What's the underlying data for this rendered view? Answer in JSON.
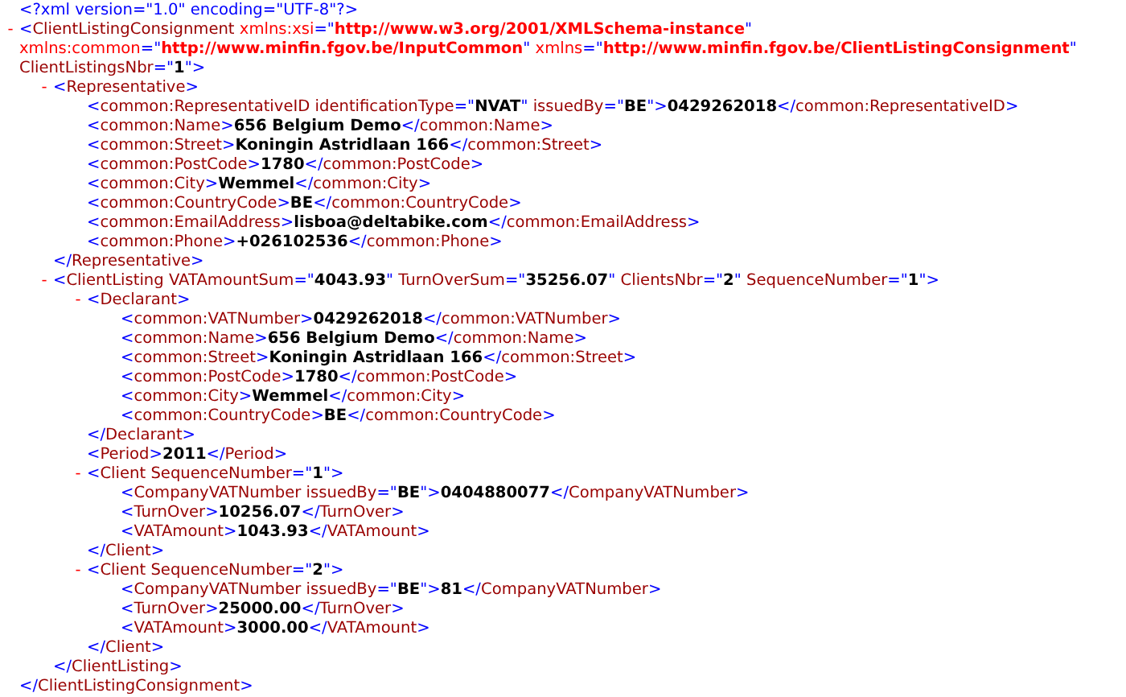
{
  "document": [
    {
      "open": [
        [
          {
            "kind": "punct",
            "text": "<?xml version=\"1.0\" encoding=\"UTF-8\"?>"
          }
        ]
      ]
    },
    {
      "toggle": "-",
      "open": [
        [
          {
            "kind": "punct",
            "text": "<"
          },
          {
            "kind": "tag",
            "text": "ClientListingConsignment"
          },
          {
            "kind": "ns-attr",
            "text": " xmlns:xsi"
          },
          {
            "kind": "punct",
            "text": "=\""
          },
          {
            "kind": "ns-value",
            "text": "http://www.w3.org/2001/XMLSchema-instance"
          },
          {
            "kind": "punct",
            "text": "\""
          }
        ],
        [
          {
            "kind": "ns-attr",
            "text": "xmlns:common"
          },
          {
            "kind": "punct",
            "text": "=\""
          },
          {
            "kind": "ns-value",
            "text": "http://www.minfin.fgov.be/InputCommon"
          },
          {
            "kind": "punct",
            "text": "\""
          },
          {
            "kind": "ns-attr",
            "text": " xmlns"
          },
          {
            "kind": "punct",
            "text": "=\""
          },
          {
            "kind": "ns-value",
            "text": "http://www.minfin.fgov.be/ClientListingConsignment"
          },
          {
            "kind": "punct",
            "text": "\""
          }
        ],
        [
          {
            "kind": "attr",
            "text": "ClientListingsNbr"
          },
          {
            "kind": "punct",
            "text": "=\""
          },
          {
            "kind": "value",
            "text": "1"
          },
          {
            "kind": "punct",
            "text": "\">"
          }
        ]
      ],
      "children": [
        {
          "toggle": "-",
          "open": [
            [
              {
                "kind": "punct",
                "text": "<"
              },
              {
                "kind": "tag",
                "text": "Representative"
              },
              {
                "kind": "punct",
                "text": ">"
              }
            ]
          ],
          "children": [
            {
              "open": [
                [
                  {
                    "kind": "punct",
                    "text": "<"
                  },
                  {
                    "kind": "tag",
                    "text": "common:RepresentativeID"
                  },
                  {
                    "kind": "attr",
                    "text": " identificationType"
                  },
                  {
                    "kind": "punct",
                    "text": "=\""
                  },
                  {
                    "kind": "value",
                    "text": "NVAT"
                  },
                  {
                    "kind": "punct",
                    "text": "\""
                  },
                  {
                    "kind": "attr",
                    "text": " issuedBy"
                  },
                  {
                    "kind": "punct",
                    "text": "=\""
                  },
                  {
                    "kind": "value",
                    "text": "BE"
                  },
                  {
                    "kind": "punct",
                    "text": "\">"
                  },
                  {
                    "kind": "value",
                    "text": "0429262018"
                  },
                  {
                    "kind": "punct",
                    "text": "</"
                  },
                  {
                    "kind": "tag",
                    "text": "common:RepresentativeID"
                  },
                  {
                    "kind": "punct",
                    "text": ">"
                  }
                ]
              ]
            },
            {
              "open": [
                [
                  {
                    "kind": "punct",
                    "text": "<"
                  },
                  {
                    "kind": "tag",
                    "text": "common:Name"
                  },
                  {
                    "kind": "punct",
                    "text": ">"
                  },
                  {
                    "kind": "value",
                    "text": "656 Belgium Demo"
                  },
                  {
                    "kind": "punct",
                    "text": "</"
                  },
                  {
                    "kind": "tag",
                    "text": "common:Name"
                  },
                  {
                    "kind": "punct",
                    "text": ">"
                  }
                ]
              ]
            },
            {
              "open": [
                [
                  {
                    "kind": "punct",
                    "text": "<"
                  },
                  {
                    "kind": "tag",
                    "text": "common:Street"
                  },
                  {
                    "kind": "punct",
                    "text": ">"
                  },
                  {
                    "kind": "value",
                    "text": "Koningin Astridlaan 166"
                  },
                  {
                    "kind": "punct",
                    "text": "</"
                  },
                  {
                    "kind": "tag",
                    "text": "common:Street"
                  },
                  {
                    "kind": "punct",
                    "text": ">"
                  }
                ]
              ]
            },
            {
              "open": [
                [
                  {
                    "kind": "punct",
                    "text": "<"
                  },
                  {
                    "kind": "tag",
                    "text": "common:PostCode"
                  },
                  {
                    "kind": "punct",
                    "text": ">"
                  },
                  {
                    "kind": "value",
                    "text": "1780"
                  },
                  {
                    "kind": "punct",
                    "text": "</"
                  },
                  {
                    "kind": "tag",
                    "text": "common:PostCode"
                  },
                  {
                    "kind": "punct",
                    "text": ">"
                  }
                ]
              ]
            },
            {
              "open": [
                [
                  {
                    "kind": "punct",
                    "text": "<"
                  },
                  {
                    "kind": "tag",
                    "text": "common:City"
                  },
                  {
                    "kind": "punct",
                    "text": ">"
                  },
                  {
                    "kind": "value",
                    "text": "Wemmel"
                  },
                  {
                    "kind": "punct",
                    "text": "</"
                  },
                  {
                    "kind": "tag",
                    "text": "common:City"
                  },
                  {
                    "kind": "punct",
                    "text": ">"
                  }
                ]
              ]
            },
            {
              "open": [
                [
                  {
                    "kind": "punct",
                    "text": "<"
                  },
                  {
                    "kind": "tag",
                    "text": "common:CountryCode"
                  },
                  {
                    "kind": "punct",
                    "text": ">"
                  },
                  {
                    "kind": "value",
                    "text": "BE"
                  },
                  {
                    "kind": "punct",
                    "text": "</"
                  },
                  {
                    "kind": "tag",
                    "text": "common:CountryCode"
                  },
                  {
                    "kind": "punct",
                    "text": ">"
                  }
                ]
              ]
            },
            {
              "open": [
                [
                  {
                    "kind": "punct",
                    "text": "<"
                  },
                  {
                    "kind": "tag",
                    "text": "common:EmailAddress"
                  },
                  {
                    "kind": "punct",
                    "text": ">"
                  },
                  {
                    "kind": "value",
                    "text": "lisboa@deltabike.com"
                  },
                  {
                    "kind": "punct",
                    "text": "</"
                  },
                  {
                    "kind": "tag",
                    "text": "common:EmailAddress"
                  },
                  {
                    "kind": "punct",
                    "text": ">"
                  }
                ]
              ]
            },
            {
              "open": [
                [
                  {
                    "kind": "punct",
                    "text": "<"
                  },
                  {
                    "kind": "tag",
                    "text": "common:Phone"
                  },
                  {
                    "kind": "punct",
                    "text": ">"
                  },
                  {
                    "kind": "value",
                    "text": "+026102536"
                  },
                  {
                    "kind": "punct",
                    "text": "</"
                  },
                  {
                    "kind": "tag",
                    "text": "common:Phone"
                  },
                  {
                    "kind": "punct",
                    "text": ">"
                  }
                ]
              ]
            }
          ],
          "close": [
            {
              "kind": "punct",
              "text": "</"
            },
            {
              "kind": "tag",
              "text": "Representative"
            },
            {
              "kind": "punct",
              "text": ">"
            }
          ]
        },
        {
          "toggle": "-",
          "open": [
            [
              {
                "kind": "punct",
                "text": "<"
              },
              {
                "kind": "tag",
                "text": "ClientListing"
              },
              {
                "kind": "attr",
                "text": " VATAmountSum"
              },
              {
                "kind": "punct",
                "text": "=\""
              },
              {
                "kind": "value",
                "text": "4043.93"
              },
              {
                "kind": "punct",
                "text": "\""
              },
              {
                "kind": "attr",
                "text": " TurnOverSum"
              },
              {
                "kind": "punct",
                "text": "=\""
              },
              {
                "kind": "value",
                "text": "35256.07"
              },
              {
                "kind": "punct",
                "text": "\""
              },
              {
                "kind": "attr",
                "text": " ClientsNbr"
              },
              {
                "kind": "punct",
                "text": "=\""
              },
              {
                "kind": "value",
                "text": "2"
              },
              {
                "kind": "punct",
                "text": "\""
              },
              {
                "kind": "attr",
                "text": " SequenceNumber"
              },
              {
                "kind": "punct",
                "text": "=\""
              },
              {
                "kind": "value",
                "text": "1"
              },
              {
                "kind": "punct",
                "text": "\">"
              }
            ]
          ],
          "children": [
            {
              "toggle": "-",
              "open": [
                [
                  {
                    "kind": "punct",
                    "text": "<"
                  },
                  {
                    "kind": "tag",
                    "text": "Declarant"
                  },
                  {
                    "kind": "punct",
                    "text": ">"
                  }
                ]
              ],
              "children": [
                {
                  "open": [
                    [
                      {
                        "kind": "punct",
                        "text": "<"
                      },
                      {
                        "kind": "tag",
                        "text": "common:VATNumber"
                      },
                      {
                        "kind": "punct",
                        "text": ">"
                      },
                      {
                        "kind": "value",
                        "text": "0429262018"
                      },
                      {
                        "kind": "punct",
                        "text": "</"
                      },
                      {
                        "kind": "tag",
                        "text": "common:VATNumber"
                      },
                      {
                        "kind": "punct",
                        "text": ">"
                      }
                    ]
                  ]
                },
                {
                  "open": [
                    [
                      {
                        "kind": "punct",
                        "text": "<"
                      },
                      {
                        "kind": "tag",
                        "text": "common:Name"
                      },
                      {
                        "kind": "punct",
                        "text": ">"
                      },
                      {
                        "kind": "value",
                        "text": "656 Belgium Demo"
                      },
                      {
                        "kind": "punct",
                        "text": "</"
                      },
                      {
                        "kind": "tag",
                        "text": "common:Name"
                      },
                      {
                        "kind": "punct",
                        "text": ">"
                      }
                    ]
                  ]
                },
                {
                  "open": [
                    [
                      {
                        "kind": "punct",
                        "text": "<"
                      },
                      {
                        "kind": "tag",
                        "text": "common:Street"
                      },
                      {
                        "kind": "punct",
                        "text": ">"
                      },
                      {
                        "kind": "value",
                        "text": "Koningin Astridlaan 166"
                      },
                      {
                        "kind": "punct",
                        "text": "</"
                      },
                      {
                        "kind": "tag",
                        "text": "common:Street"
                      },
                      {
                        "kind": "punct",
                        "text": ">"
                      }
                    ]
                  ]
                },
                {
                  "open": [
                    [
                      {
                        "kind": "punct",
                        "text": "<"
                      },
                      {
                        "kind": "tag",
                        "text": "common:PostCode"
                      },
                      {
                        "kind": "punct",
                        "text": ">"
                      },
                      {
                        "kind": "value",
                        "text": "1780"
                      },
                      {
                        "kind": "punct",
                        "text": "</"
                      },
                      {
                        "kind": "tag",
                        "text": "common:PostCode"
                      },
                      {
                        "kind": "punct",
                        "text": ">"
                      }
                    ]
                  ]
                },
                {
                  "open": [
                    [
                      {
                        "kind": "punct",
                        "text": "<"
                      },
                      {
                        "kind": "tag",
                        "text": "common:City"
                      },
                      {
                        "kind": "punct",
                        "text": ">"
                      },
                      {
                        "kind": "value",
                        "text": "Wemmel"
                      },
                      {
                        "kind": "punct",
                        "text": "</"
                      },
                      {
                        "kind": "tag",
                        "text": "common:City"
                      },
                      {
                        "kind": "punct",
                        "text": ">"
                      }
                    ]
                  ]
                },
                {
                  "open": [
                    [
                      {
                        "kind": "punct",
                        "text": "<"
                      },
                      {
                        "kind": "tag",
                        "text": "common:CountryCode"
                      },
                      {
                        "kind": "punct",
                        "text": ">"
                      },
                      {
                        "kind": "value",
                        "text": "BE"
                      },
                      {
                        "kind": "punct",
                        "text": "</"
                      },
                      {
                        "kind": "tag",
                        "text": "common:CountryCode"
                      },
                      {
                        "kind": "punct",
                        "text": ">"
                      }
                    ]
                  ]
                }
              ],
              "close": [
                {
                  "kind": "punct",
                  "text": "</"
                },
                {
                  "kind": "tag",
                  "text": "Declarant"
                },
                {
                  "kind": "punct",
                  "text": ">"
                }
              ]
            },
            {
              "open": [
                [
                  {
                    "kind": "punct",
                    "text": "<"
                  },
                  {
                    "kind": "tag",
                    "text": "Period"
                  },
                  {
                    "kind": "punct",
                    "text": ">"
                  },
                  {
                    "kind": "value",
                    "text": "2011"
                  },
                  {
                    "kind": "punct",
                    "text": "</"
                  },
                  {
                    "kind": "tag",
                    "text": "Period"
                  },
                  {
                    "kind": "punct",
                    "text": ">"
                  }
                ]
              ]
            },
            {
              "toggle": "-",
              "open": [
                [
                  {
                    "kind": "punct",
                    "text": "<"
                  },
                  {
                    "kind": "tag",
                    "text": "Client"
                  },
                  {
                    "kind": "attr",
                    "text": " SequenceNumber"
                  },
                  {
                    "kind": "punct",
                    "text": "=\""
                  },
                  {
                    "kind": "value",
                    "text": "1"
                  },
                  {
                    "kind": "punct",
                    "text": "\">"
                  }
                ]
              ],
              "children": [
                {
                  "open": [
                    [
                      {
                        "kind": "punct",
                        "text": "<"
                      },
                      {
                        "kind": "tag",
                        "text": "CompanyVATNumber"
                      },
                      {
                        "kind": "attr",
                        "text": " issuedBy"
                      },
                      {
                        "kind": "punct",
                        "text": "=\""
                      },
                      {
                        "kind": "value",
                        "text": "BE"
                      },
                      {
                        "kind": "punct",
                        "text": "\">"
                      },
                      {
                        "kind": "value",
                        "text": "0404880077"
                      },
                      {
                        "kind": "punct",
                        "text": "</"
                      },
                      {
                        "kind": "tag",
                        "text": "CompanyVATNumber"
                      },
                      {
                        "kind": "punct",
                        "text": ">"
                      }
                    ]
                  ]
                },
                {
                  "open": [
                    [
                      {
                        "kind": "punct",
                        "text": "<"
                      },
                      {
                        "kind": "tag",
                        "text": "TurnOver"
                      },
                      {
                        "kind": "punct",
                        "text": ">"
                      },
                      {
                        "kind": "value",
                        "text": "10256.07"
                      },
                      {
                        "kind": "punct",
                        "text": "</"
                      },
                      {
                        "kind": "tag",
                        "text": "TurnOver"
                      },
                      {
                        "kind": "punct",
                        "text": ">"
                      }
                    ]
                  ]
                },
                {
                  "open": [
                    [
                      {
                        "kind": "punct",
                        "text": "<"
                      },
                      {
                        "kind": "tag",
                        "text": "VATAmount"
                      },
                      {
                        "kind": "punct",
                        "text": ">"
                      },
                      {
                        "kind": "value",
                        "text": "1043.93"
                      },
                      {
                        "kind": "punct",
                        "text": "</"
                      },
                      {
                        "kind": "tag",
                        "text": "VATAmount"
                      },
                      {
                        "kind": "punct",
                        "text": ">"
                      }
                    ]
                  ]
                }
              ],
              "close": [
                {
                  "kind": "punct",
                  "text": "</"
                },
                {
                  "kind": "tag",
                  "text": "Client"
                },
                {
                  "kind": "punct",
                  "text": ">"
                }
              ]
            },
            {
              "toggle": "-",
              "open": [
                [
                  {
                    "kind": "punct",
                    "text": "<"
                  },
                  {
                    "kind": "tag",
                    "text": "Client"
                  },
                  {
                    "kind": "attr",
                    "text": " SequenceNumber"
                  },
                  {
                    "kind": "punct",
                    "text": "=\""
                  },
                  {
                    "kind": "value",
                    "text": "2"
                  },
                  {
                    "kind": "punct",
                    "text": "\">"
                  }
                ]
              ],
              "children": [
                {
                  "open": [
                    [
                      {
                        "kind": "punct",
                        "text": "<"
                      },
                      {
                        "kind": "tag",
                        "text": "CompanyVATNumber"
                      },
                      {
                        "kind": "attr",
                        "text": " issuedBy"
                      },
                      {
                        "kind": "punct",
                        "text": "=\""
                      },
                      {
                        "kind": "value",
                        "text": "BE"
                      },
                      {
                        "kind": "punct",
                        "text": "\">"
                      },
                      {
                        "kind": "value",
                        "text": "81"
                      },
                      {
                        "kind": "punct",
                        "text": "</"
                      },
                      {
                        "kind": "tag",
                        "text": "CompanyVATNumber"
                      },
                      {
                        "kind": "punct",
                        "text": ">"
                      }
                    ]
                  ]
                },
                {
                  "open": [
                    [
                      {
                        "kind": "punct",
                        "text": "<"
                      },
                      {
                        "kind": "tag",
                        "text": "TurnOver"
                      },
                      {
                        "kind": "punct",
                        "text": ">"
                      },
                      {
                        "kind": "value",
                        "text": "25000.00"
                      },
                      {
                        "kind": "punct",
                        "text": "</"
                      },
                      {
                        "kind": "tag",
                        "text": "TurnOver"
                      },
                      {
                        "kind": "punct",
                        "text": ">"
                      }
                    ]
                  ]
                },
                {
                  "open": [
                    [
                      {
                        "kind": "punct",
                        "text": "<"
                      },
                      {
                        "kind": "tag",
                        "text": "VATAmount"
                      },
                      {
                        "kind": "punct",
                        "text": ">"
                      },
                      {
                        "kind": "value",
                        "text": "3000.00"
                      },
                      {
                        "kind": "punct",
                        "text": "</"
                      },
                      {
                        "kind": "tag",
                        "text": "VATAmount"
                      },
                      {
                        "kind": "punct",
                        "text": ">"
                      }
                    ]
                  ]
                }
              ],
              "close": [
                {
                  "kind": "punct",
                  "text": "</"
                },
                {
                  "kind": "tag",
                  "text": "Client"
                },
                {
                  "kind": "punct",
                  "text": ">"
                }
              ]
            }
          ],
          "close": [
            {
              "kind": "punct",
              "text": "</"
            },
            {
              "kind": "tag",
              "text": "ClientListing"
            },
            {
              "kind": "punct",
              "text": ">"
            }
          ]
        }
      ],
      "close": [
        {
          "kind": "punct",
          "text": "</"
        },
        {
          "kind": "tag",
          "text": "ClientListingConsignment"
        },
        {
          "kind": "punct",
          "text": ">"
        }
      ]
    }
  ]
}
